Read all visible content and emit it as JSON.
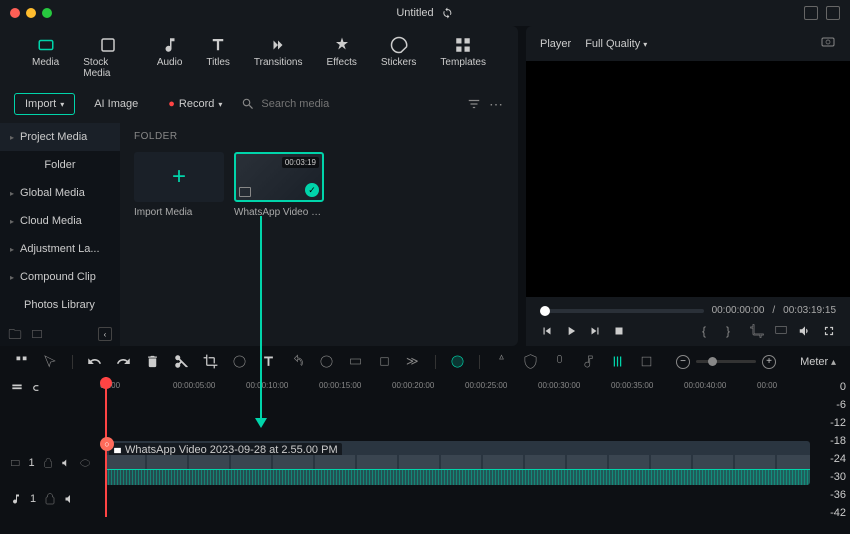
{
  "title": "Untitled",
  "tabs": {
    "media": "Media",
    "stock": "Stock Media",
    "audio": "Audio",
    "titles": "Titles",
    "transitions": "Transitions",
    "effects": "Effects",
    "stickers": "Stickers",
    "templates": "Templates"
  },
  "buttons": {
    "import": "Import",
    "ai_image": "AI Image",
    "record": "Record"
  },
  "search_placeholder": "Search media",
  "sidebar": {
    "hdr": "Project Media",
    "folder": "Folder",
    "items": [
      "Global Media",
      "Cloud Media",
      "Adjustment La...",
      "Compound Clip",
      "Photos Library"
    ]
  },
  "folder_label": "FOLDER",
  "media": {
    "import": "Import Media",
    "clip_name": "WhatsApp Video 202...",
    "clip_dur": "00:03:19"
  },
  "player": {
    "label": "Player",
    "quality": "Full Quality",
    "cur": "00:00:00:00",
    "total": "00:03:19:15",
    "sep": "/"
  },
  "ruler": [
    "00:00",
    "00:00:05:00",
    "00:00:10:00",
    "00:00:15:00",
    "00:00:20:00",
    "00:00:25:00",
    "00:00:30:00",
    "00:00:35:00",
    "00:00:40:00",
    "00:00"
  ],
  "clip_label": "WhatsApp Video 2023-09-28 at 2.55.00 PM",
  "meter_label": "Meter",
  "meter_vals": [
    "0",
    "-6",
    "-12",
    "-18",
    "-24",
    "-30",
    "-36",
    "-42"
  ],
  "track_v": "1",
  "track_a": "1"
}
